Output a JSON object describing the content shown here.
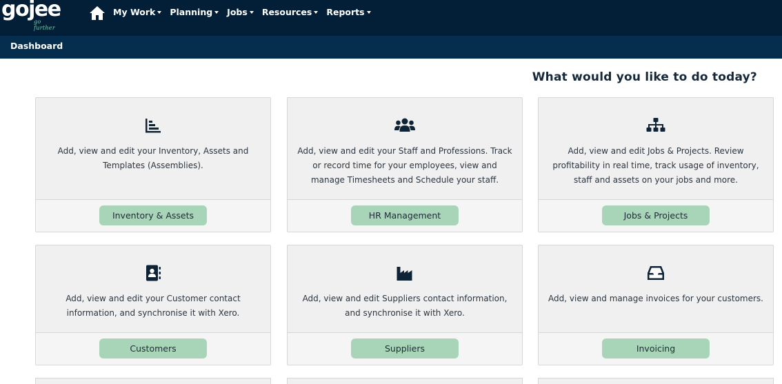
{
  "app": {
    "logo_text": "gojee",
    "logo_tagline": "go further"
  },
  "nav": {
    "items": [
      {
        "label": "My Work"
      },
      {
        "label": "Planning"
      },
      {
        "label": "Jobs"
      },
      {
        "label": "Resources"
      },
      {
        "label": "Reports"
      }
    ]
  },
  "breadcrumb": {
    "current": "Dashboard"
  },
  "main": {
    "heading": "What would you like to do today?",
    "cards": [
      {
        "icon": "bar-chart-icon",
        "description": "Add, view and edit your Inventory, Assets and Templates (Assemblies).",
        "button": "Inventory & Assets"
      },
      {
        "icon": "users-icon",
        "description": "Add, view and edit your Staff and Professions. Track or record time for your employees, view and manage Timesheets and Schedule your staff.",
        "button": "HR Management"
      },
      {
        "icon": "sitemap-icon",
        "description": "Add, view and edit Jobs & Projects. Review profitability in real time, track usage of inventory, staff and assets on your jobs and more.",
        "button": "Jobs & Projects"
      },
      {
        "icon": "address-book-icon",
        "description": "Add, view and edit your Customer contact information, and synchronise it with Xero.",
        "button": "Customers"
      },
      {
        "icon": "industry-icon",
        "description": "Add, view and edit Suppliers contact information, and synchronise it with Xero.",
        "button": "Suppliers"
      },
      {
        "icon": "inbox-icon",
        "description": "Add, view and manage invoices for your customers.",
        "button": "Invoicing"
      }
    ]
  },
  "colors": {
    "navbar": "#021f37",
    "subbar": "#042d4e",
    "button": "#a8d5b8",
    "card": "#f0f0f0"
  }
}
